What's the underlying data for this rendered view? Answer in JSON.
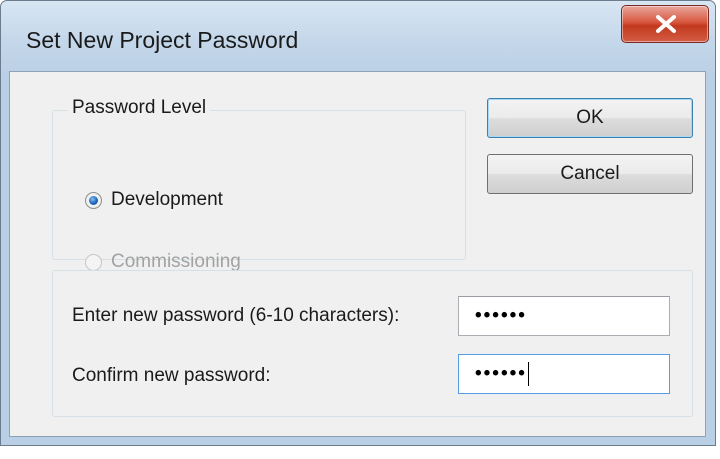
{
  "window": {
    "title": "Set New Project Password"
  },
  "group_level": {
    "caption": "Password Level",
    "options": [
      {
        "label": "Development",
        "checked": true,
        "enabled": true
      },
      {
        "label": "Commissioning",
        "checked": false,
        "enabled": false
      }
    ]
  },
  "buttons": {
    "ok": "OK",
    "cancel": "Cancel"
  },
  "password_fields": {
    "new_label": "Enter new password (6-10 characters):",
    "new_value": "••••••",
    "confirm_label": "Confirm new password:",
    "confirm_value": "••••••"
  },
  "colors": {
    "client_bg": "#f0f0f0",
    "close_button": "#c2391f",
    "focus_border": "#569de5",
    "radio_dot": "#1a5fb4"
  },
  "icons": {
    "close": "close-x-icon"
  }
}
